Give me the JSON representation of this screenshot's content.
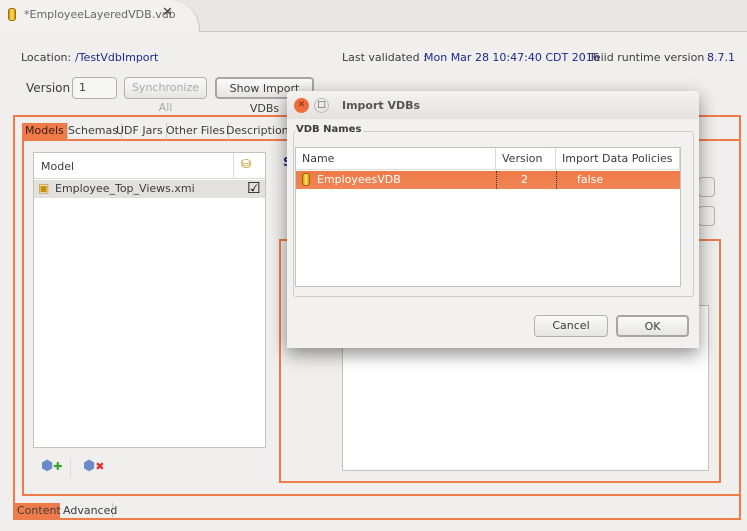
{
  "editor_tab": {
    "title": "*EmployeeLayeredVDB.vdb"
  },
  "info": {
    "location_label": "Location:",
    "location_value": "/TestVdbImport",
    "validated_label": "Last validated :",
    "validated_value": "Mon Mar 28 10:47:40 CDT 2016",
    "runtime_label": "Teiid runtime version :",
    "runtime_value": "8.7.1"
  },
  "version": {
    "label": "Version",
    "value": "1",
    "sync_label": "Synchronize All",
    "show_import_label": "Show Import VDBs"
  },
  "tabs": [
    "Models",
    "Schemas",
    "UDF Jars",
    "Other Files",
    "Description"
  ],
  "models_table": {
    "header": "Model",
    "rows": [
      {
        "name": "Employee_Top_Views.xmi",
        "checked": true
      }
    ]
  },
  "bottom_tabs": [
    "Content",
    "Advanced"
  ],
  "right_pane": {
    "section_initial": "S"
  },
  "dialog": {
    "title": "Import VDBs",
    "group": "VDB Names",
    "columns": [
      "Name",
      "Version",
      "Import Data Policies"
    ],
    "rows": [
      {
        "name": "EmployeesVDB",
        "version": "2",
        "policies": "false"
      }
    ],
    "cancel": "Cancel",
    "ok": "OK"
  },
  "colors": {
    "accent": "#f07b4a",
    "link": "#1c2a8c"
  }
}
